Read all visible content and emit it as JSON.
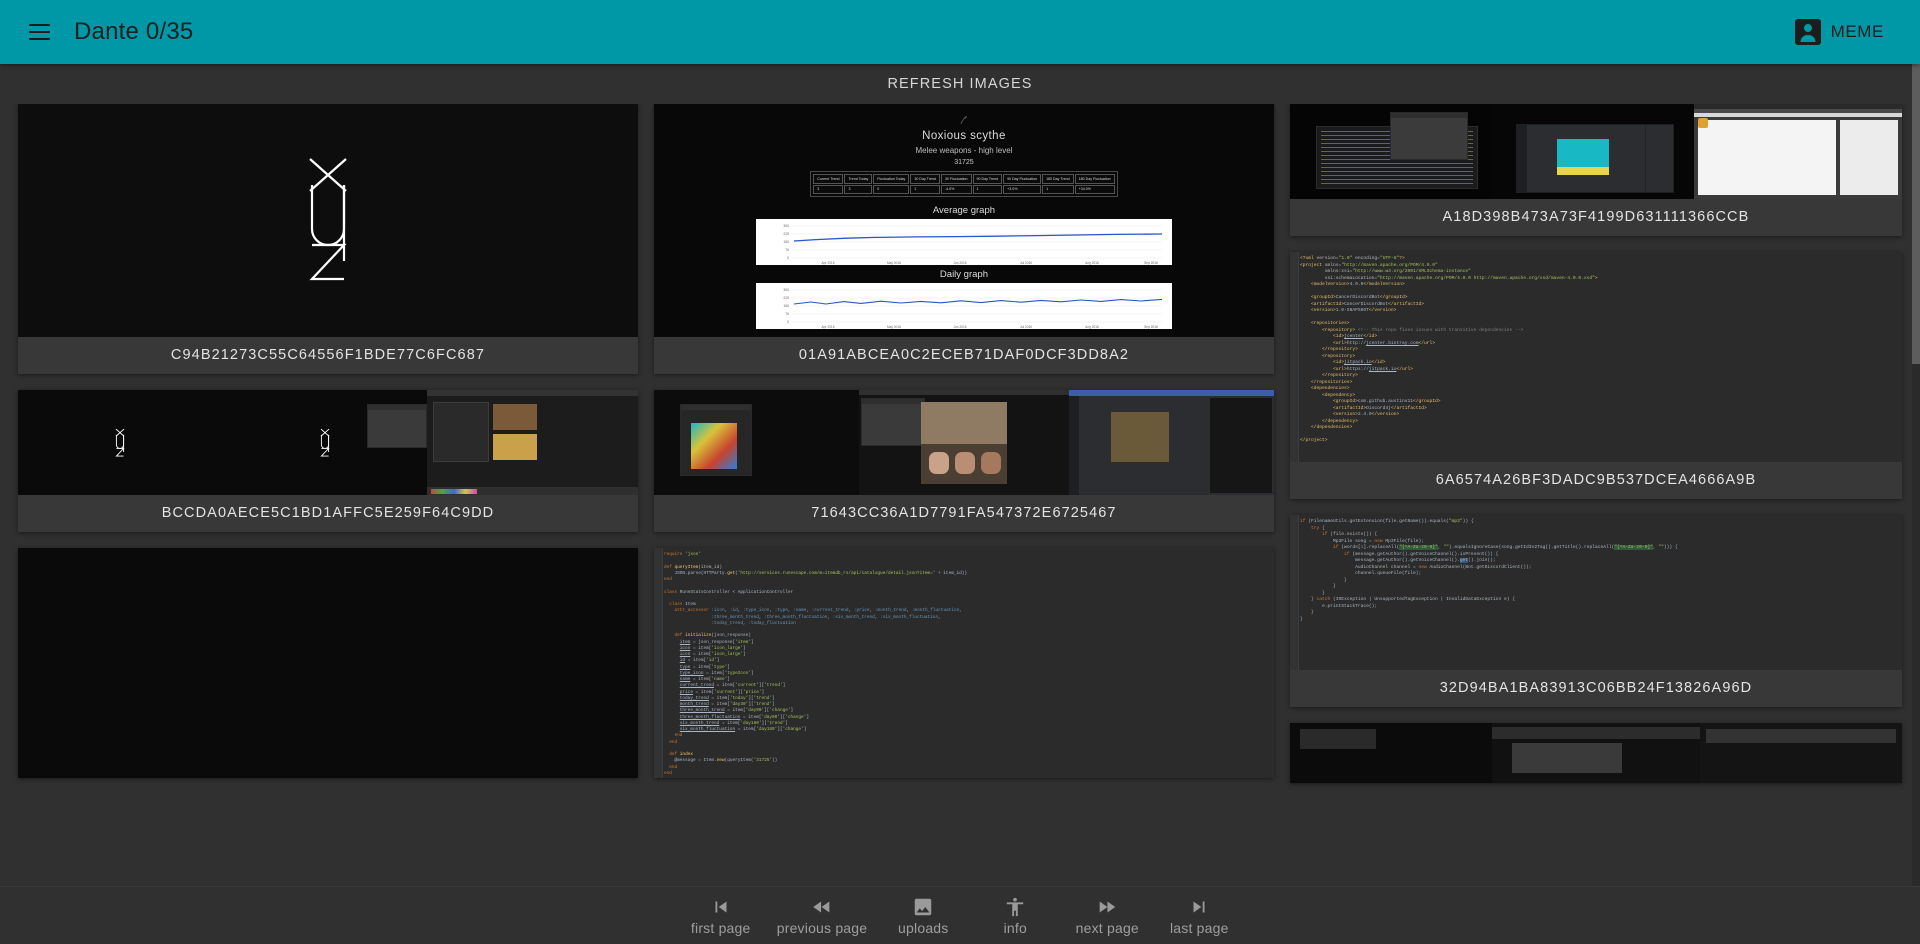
{
  "appbar": {
    "menu_icon": "hamburger-menu-icon",
    "title": "Dante 0/35",
    "account_icon": "account-box-icon",
    "account_label": "MEME"
  },
  "toolbar": {
    "refresh_label": "REFRESH IMAGES"
  },
  "cards": [
    {
      "id": "card-1",
      "hash": "C94B21273C55C64556F1BDE77C6FC687",
      "kind": "monogram",
      "description": "white stylised x-y-z monogram on black background"
    },
    {
      "id": "card-2",
      "hash": "01A91ABCEA0C2ECEB71DAF0DCF3DD8A2",
      "kind": "runescape-price-page",
      "item_title": "Noxious scythe",
      "item_category": "Melee weapons - high level",
      "item_price": "31725",
      "table_headers": [
        "Current Trend",
        "Trend Today",
        "Fluctuation Today",
        "30 Day Trend",
        "30 Fluctuation",
        "90 Day Trend",
        "90 Day Fluctuation",
        "180 Day Trend",
        "180 Day Fluctuation"
      ],
      "table_values": [
        "3",
        "3",
        "0",
        "1",
        "-4.0%",
        "1",
        "+3.0%",
        "1",
        "+34.0%"
      ],
      "graphs": [
        {
          "label": "Average graph"
        },
        {
          "label": "Daily graph"
        }
      ],
      "y_ticks": [
        "300",
        "225",
        "150",
        "75",
        "0"
      ],
      "x_ticks": [
        "Apr 2016",
        "May 2016",
        "Jun 2016",
        "Jul 2016",
        "Aug 2016",
        "Sep 2016"
      ]
    },
    {
      "id": "card-3",
      "hash": "A18D398B473A73F4199D631111366CCB",
      "kind": "triple-monitor-desktop",
      "description": "three monitor desktop with terminal, Discord and a browser"
    },
    {
      "id": "card-4",
      "hash": "BCCDA0AECE5C1BD1AFFC5E259F64C9DD",
      "kind": "desktop-monogram",
      "description": "dual monogram wallpapers with editor and browser windows"
    },
    {
      "id": "card-5",
      "hash": "71643CC36A1D7791FA547372E6725467",
      "kind": "desktop-videocall",
      "description": "desktop with image editor, group video call and Discord chat"
    },
    {
      "id": "card-6",
      "hash": "6A6574A26BF3DADC9B537DCEA4666A9B",
      "kind": "code-xml",
      "description": "Maven pom.xml for CancerDiscordBot"
    },
    {
      "id": "card-7",
      "hash": "",
      "kind": "black-image",
      "description": "mostly black image"
    },
    {
      "id": "card-8",
      "hash": "",
      "kind": "code-ruby",
      "description": "Ruby on Rails RuneStatsController source"
    },
    {
      "id": "card-9",
      "hash": "32D94BA1BA83913C06BB24F13826A96D",
      "kind": "code-java",
      "description": "Java mp3 playback snippet"
    },
    {
      "id": "card-10",
      "hash": "",
      "kind": "desktop-dark",
      "description": "partially visible dark desktop screenshot"
    }
  ],
  "code": {
    "pom_xml": [
      "<?xml version=\"1.0\" encoding=\"UTF-8\"?>",
      "<project xmlns=\"http://maven.apache.org/POM/4.0.0\"",
      "         xmlns:xsi=\"http://www.w3.org/2001/XMLSchema-instance\"",
      "         xsi:schemaLocation=\"http://maven.apache.org/POM/4.0.0 http://maven.apache.org/xsd/maven-4.0.0.xsd\">",
      "    <modelVersion>4.0.0</modelVersion>",
      "",
      "    <groupId>CancerDiscordBot</groupId>",
      "    <artifactId>CancerDiscordBot</artifactId>",
      "    <version>1.0-SNAPSHOT</version>",
      "",
      "    <repositories>",
      "        <repository> <!-- This repo fixes issues with transitive dependencies -->",
      "            <id>jcenter</id>",
      "            <url>http://jcenter.bintray.com</url>",
      "        </repository>",
      "        <repository>",
      "            <id>jitpack.io</id>",
      "            <url>https://jitpack.io</url>",
      "        </repository>",
      "    </repositories>",
      "    <dependencies>",
      "        <dependency>",
      "            <groupId>com.github.austinv11</groupId>",
      "            <artifactId>Discord4j</artifactId>",
      "            <version>2.4.9</version>",
      "        </dependency>",
      "    </dependencies>",
      "",
      "</project>"
    ],
    "java_snippet": [
      "if (FilenameUtils.getExtension(file.getName()).equals(\"mp3\")) {",
      "    try {",
      "        if (file.exists()) {",
      "            Mp3File song = new Mp3File(file);",
      "            if (words[1].replaceAll(\"[^A-Za-z0-9]\", \"\").equalsIgnoreCase(song.getId3v2Tag().getTitle().replaceAll(\"[^A-Za-z0-9]\", \"\"))) {",
      "                if (message.getAuthor().getVoiceChannel().isPresent()) {",
      "                    message.getAuthor().getVoiceChannel().get().join();",
      "                    AudioChannel channel = new AudioChannel(Bot.getDiscordClient());",
      "                    channel.queueFile(file);",
      "                }",
      "            }",
      "        }",
      "    } catch (IOException | UnsupportedTagException | InvalidDataException e) {",
      "        e.printStackTrace();",
      "    }",
      "}"
    ],
    "ruby_snippet": [
      "require 'json'",
      "",
      "def queryItem(item_id)",
      "    JSON.parse(HTTParty.get('http://services.runescape.com/m=itemdb_rs/api/catalogue/detail.json?item=' + item_id))",
      "end",
      "",
      "class RuneStatsController < ApplicationController",
      "",
      "  class Item",
      "    attr_accessor :icon, :id, :type_icon, :type, :name, :current_trend, :price, :month_trend, :month_fluctuation,",
      "                  :three_month_trend, :three_month_fluctuation, :six_month_trend, :six_month_fluctuation,",
      "                  :today_trend, :today_fluctuation",
      "",
      "    def initialize(json_response)",
      "      item = json_response['item']",
      "      icon = item['icon']",
      "      icon_large = item['icon_large']",
      "      id = item['id']",
      "      type = item['type']",
      "      type_icon = item['typeIcon']",
      "      name = item['name']",
      "      current_trend = item['current']['trend']",
      "      price = item['current']['price']",
      "      today_trend = item['today']['trend']",
      "      month_trend = item['day30']['trend']",
      "      three_month_trend = item['day90']['change']",
      "      three_month_fluctuation = item['day90']['change']",
      "      six_month_trend = item['day180']['trend']",
      "      six_month_fluctuation = item['day180']['change']",
      "    end",
      "  end",
      "",
      "  def index",
      "    @message = Item.new(queryItem('31725'))",
      "  end",
      "end"
    ]
  },
  "bottomnav": [
    {
      "icon": "skip-previous-icon",
      "label": "first page"
    },
    {
      "icon": "fast-rewind-icon",
      "label": "previous page"
    },
    {
      "icon": "image-icon",
      "label": "uploads"
    },
    {
      "icon": "accessibility-icon",
      "label": "info"
    },
    {
      "icon": "fast-forward-icon",
      "label": "next page"
    },
    {
      "icon": "skip-next-icon",
      "label": "last page"
    }
  ],
  "colors": {
    "appbar": "#0097a7",
    "background": "#303030",
    "card": "#383838",
    "caption_text": "#e3e3e3",
    "nav_text": "#9e9e9e"
  }
}
